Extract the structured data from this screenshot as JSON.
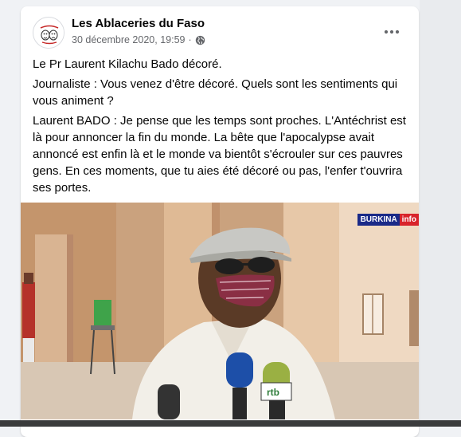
{
  "post": {
    "page_name": "Les Ablaceries du Faso",
    "date": "30 décembre 2020, 19:59",
    "separator": "·",
    "privacy_icon": "globe-icon",
    "more_icon": "more-dots-icon",
    "paragraphs": [
      "Le Pr Laurent Kilachu Bado décoré.",
      "Journaliste : Vous venez d'être décoré. Quels sont les sentiments qui vous animent ?",
      "Laurent BADO : Je pense que les temps sont proches. L'Antéchrist est là pour annoncer la fin du monde. La bête que l'apocalypse avait annoncé est enfin là et le monde va bientôt s'écrouler sur ces pauvres gens. En ces moments, que tu aies été décoré ou pas, l'enfer t'ouvrira ses portes."
    ]
  },
  "photo": {
    "logo_text_1": "BURKINA",
    "logo_text_2": "info"
  },
  "colors": {
    "page_bg": "#f0f2f5",
    "card_bg": "#ffffff",
    "text_primary": "#050505",
    "text_secondary": "#65676b"
  }
}
